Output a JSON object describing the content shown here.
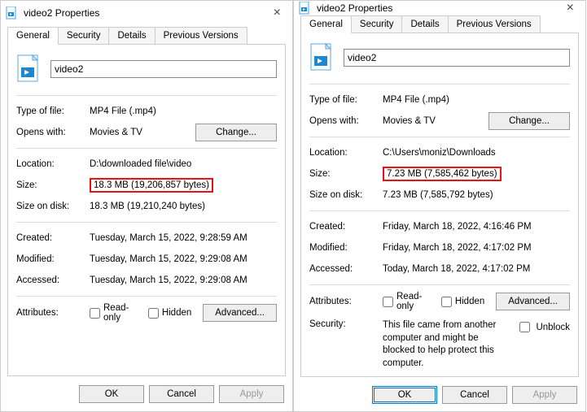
{
  "windows": [
    {
      "title": "video2 Properties",
      "tabs": [
        "General",
        "Security",
        "Details",
        "Previous Versions"
      ],
      "activeTab": "General",
      "filename": "video2",
      "typeLabel": "Type of file:",
      "typeValue": "MP4 File (.mp4)",
      "opensLabel": "Opens with:",
      "opensValue": "Movies & TV",
      "changeBtn": "Change...",
      "locationLabel": "Location:",
      "locationValue": "D:\\downloaded file\\video",
      "sizeLabel": "Size:",
      "sizeValue": "18.3 MB (19,206,857 bytes)",
      "sizeOnDiskLabel": "Size on disk:",
      "sizeOnDiskValue": "18.3 MB (19,210,240 bytes)",
      "createdLabel": "Created:",
      "createdValue": "Tuesday, March 15, 2022, 9:28:59 AM",
      "modifiedLabel": "Modified:",
      "modifiedValue": "Tuesday, March 15, 2022, 9:29:08 AM",
      "accessedLabel": "Accessed:",
      "accessedValue": "Tuesday, March 15, 2022, 9:29:08 AM",
      "attributesLabel": "Attributes:",
      "readOnly": "Read-only",
      "hidden": "Hidden",
      "advancedBtn": "Advanced...",
      "okBtn": "OK",
      "cancelBtn": "Cancel",
      "applyBtn": "Apply",
      "hasSecurityMsg": false
    },
    {
      "title": "video2 Properties",
      "tabs": [
        "General",
        "Security",
        "Details",
        "Previous Versions"
      ],
      "activeTab": "General",
      "filename": "video2",
      "typeLabel": "Type of file:",
      "typeValue": "MP4 File (.mp4)",
      "opensLabel": "Opens with:",
      "opensValue": "Movies & TV",
      "changeBtn": "Change...",
      "locationLabel": "Location:",
      "locationValue": "C:\\Users\\moniz\\Downloads",
      "sizeLabel": "Size:",
      "sizeValue": "7.23 MB (7,585,462 bytes)",
      "sizeOnDiskLabel": "Size on disk:",
      "sizeOnDiskValue": "7.23 MB (7,585,792 bytes)",
      "createdLabel": "Created:",
      "createdValue": "Friday, March 18, 2022, 4:16:46 PM",
      "modifiedLabel": "Modified:",
      "modifiedValue": "Friday, March 18, 2022, 4:17:02 PM",
      "accessedLabel": "Accessed:",
      "accessedValue": "Today, March 18, 2022, 4:17:02 PM",
      "attributesLabel": "Attributes:",
      "readOnly": "Read-only",
      "hidden": "Hidden",
      "advancedBtn": "Advanced...",
      "securityLabel": "Security:",
      "securityMsg": "This file came from another computer and might be blocked to help protect this computer.",
      "unblockLabel": "Unblock",
      "okBtn": "OK",
      "cancelBtn": "Cancel",
      "applyBtn": "Apply",
      "hasSecurityMsg": true
    }
  ]
}
